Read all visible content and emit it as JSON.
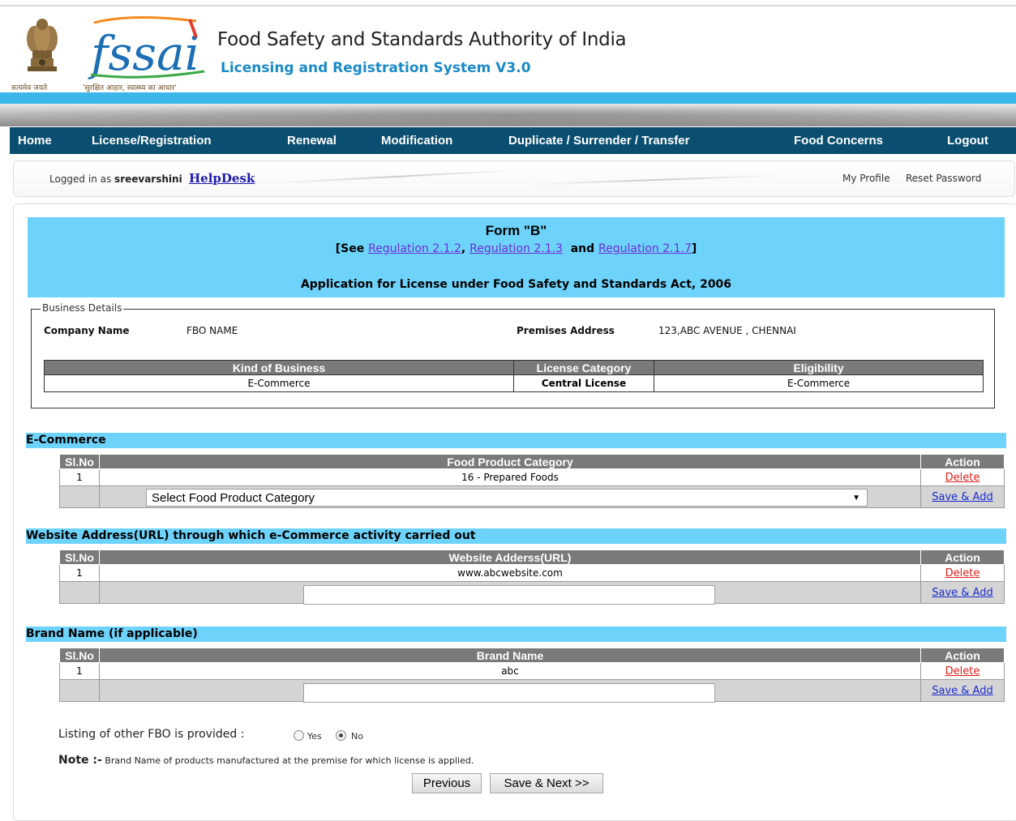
{
  "header": {
    "org_title": "Food Safety and Standards Authority of India",
    "system_title": "Licensing and Registration System V3.0",
    "emblem_caption": "सत्यमेव जयते",
    "logo_text": "fssai",
    "logo_caption": "'सुरक्षित आहार, स्वास्थ्य का आधार'"
  },
  "nav": {
    "items": [
      "Home",
      "License/Registration",
      "Renewal",
      "Modification",
      "Duplicate / Surrender / Transfer",
      "Food Concerns",
      "Logout"
    ]
  },
  "loginbar": {
    "logged_prefix": "Logged in as ",
    "username": "sreevarshini",
    "helpdesk": "HelpDesk",
    "my_profile": "My Profile",
    "reset_password": "Reset Password"
  },
  "form": {
    "title": "Form \"B\"",
    "see_prefix": "[See ",
    "reg1": "Regulation 2.1.2",
    "comma": ", ",
    "reg2": "Regulation 2.1.3",
    "and": "  and ",
    "reg3": "Regulation 2.1.7",
    "close": "]",
    "subtitle": "Application for License under Food Safety and Standards Act, 2006"
  },
  "business": {
    "legend": "Business Details",
    "company_label": "Company Name",
    "company_value": "FBO NAME",
    "premises_label": "Premises Address",
    "premises_value": "123,ABC AVENUE , CHENNAI",
    "headers": [
      "Kind of Business",
      "License Category",
      "Eligibility"
    ],
    "row": [
      "E-Commerce",
      "Central License",
      "E-Commerce"
    ]
  },
  "ecommerce": {
    "section_title": "E-Commerce",
    "headers": [
      "Sl.No",
      "Food Product Category",
      "Action"
    ],
    "rows": [
      {
        "sl": "1",
        "value": "16 - Prepared Foods",
        "action": "Delete"
      }
    ],
    "select_placeholder": "Select Food Product Category",
    "save_add": "Save & Add"
  },
  "website": {
    "section_title": "Website Address(URL) through which e-Commerce activity carried out",
    "headers": [
      "Sl.No",
      "Website Adderss(URL)",
      "Action"
    ],
    "rows": [
      {
        "sl": "1",
        "value": "www.abcwebsite.com",
        "action": "Delete"
      }
    ],
    "input_value": "",
    "save_add": "Save & Add"
  },
  "brand": {
    "section_title": "Brand Name (if applicable)",
    "headers": [
      "Sl.No",
      "Brand Name",
      "Action"
    ],
    "rows": [
      {
        "sl": "1",
        "value": "abc",
        "action": "Delete"
      }
    ],
    "input_value": "",
    "save_add": "Save & Add"
  },
  "listing": {
    "label": "Listing of other FBO is provided :",
    "options": [
      "Yes",
      "No"
    ],
    "selected": "No"
  },
  "note": {
    "prefix": "Note :-",
    "text": " Brand Name of products manufactured at the premise for which license is applied."
  },
  "buttons": {
    "previous": "Previous",
    "save_next": "Save & Next >>"
  },
  "colors": {
    "nav_bg": "#0b4f70",
    "section_bg": "#6ed3fb",
    "header_blue": "#1a8bc6",
    "table_header": "#7a7a7a",
    "delete_red": "#e0201c",
    "link_blue": "#1a2cd0"
  }
}
